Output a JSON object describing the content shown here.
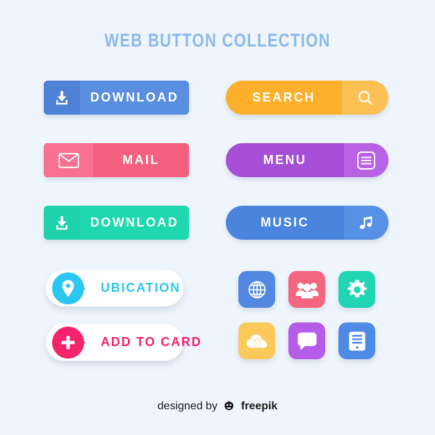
{
  "header": {
    "title": "WEB BUTTON COLLECTION",
    "title_color": "#8cb8ea"
  },
  "background_color": "#eff5fd",
  "buttons": [
    {
      "id": "download-blue",
      "label": "DOWNLOAD",
      "icon": "download-icon",
      "icon_side": "left",
      "shape": "rounded-rect",
      "color": "#5a8ee0",
      "panel_color": "#4f82d6",
      "text_color": "#ffffff"
    },
    {
      "id": "search",
      "label": "SEARCH",
      "icon": "search-icon",
      "icon_side": "right",
      "shape": "pill",
      "color": "#fdb02b",
      "panel_color": "#fdc055",
      "text_color": "#ffffff"
    },
    {
      "id": "mail",
      "label": "MAIL",
      "icon": "envelope-icon",
      "icon_side": "left",
      "shape": "rounded-rect",
      "color": "#f4607f",
      "panel_color": "#f87190",
      "text_color": "#ffffff"
    },
    {
      "id": "menu",
      "label": "MENU",
      "icon": "hamburger-menu-icon",
      "icon_side": "right",
      "shape": "pill",
      "color": "#a64fd6",
      "panel_color": "#b862e4",
      "text_color": "#ffffff"
    },
    {
      "id": "download-green",
      "label": "DOWNLOAD",
      "icon": "download-icon",
      "icon_side": "left",
      "shape": "rounded-rect",
      "color": "#1fd8b0",
      "panel_color": "#1ed3ac",
      "text_color": "#ffffff"
    },
    {
      "id": "music",
      "label": "MUSIC",
      "icon": "music-note-icon",
      "icon_side": "right",
      "shape": "pill",
      "color": "#4a84dd",
      "panel_color": "#5791e6",
      "text_color": "#ffffff"
    }
  ],
  "pill_buttons": [
    {
      "id": "ubication",
      "label": "UBICATION",
      "icon": "location-pin-icon",
      "accent_color": "#2ac7f0",
      "background_color": "#ffffff"
    },
    {
      "id": "add-to-card",
      "label": "ADD TO CARD",
      "icon": "plus-icon",
      "accent_color": "#f4246c",
      "background_color": "#ffffff"
    }
  ],
  "icon_tiles": [
    {
      "id": "globe",
      "icon": "globe-icon",
      "color": "#5287e2"
    },
    {
      "id": "users",
      "icon": "users-group-icon",
      "color": "#f4667f"
    },
    {
      "id": "gear",
      "icon": "gear-icon",
      "color": "#20d6b2"
    },
    {
      "id": "cloud",
      "icon": "cloud-upload-icon",
      "color": "#fbc85a"
    },
    {
      "id": "chat",
      "icon": "chat-bubble-icon",
      "color": "#b55ce8"
    },
    {
      "id": "server",
      "icon": "server-icon",
      "color": "#4e8ae6"
    }
  ],
  "footer": {
    "designed_by": "designed by",
    "brand": "freepik",
    "logo": "freepik-robot-icon"
  }
}
